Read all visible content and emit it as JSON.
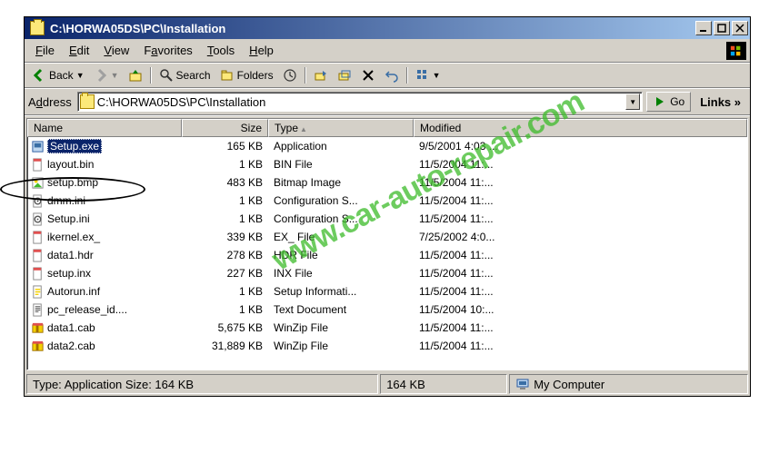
{
  "titlebar": {
    "title": "C:\\HORWA05DS\\PC\\Installation"
  },
  "menubar": {
    "file": "File",
    "edit": "Edit",
    "view": "View",
    "favorites": "Favorites",
    "tools": "Tools",
    "help": "Help"
  },
  "toolbar": {
    "back": "Back",
    "search": "Search",
    "folders": "Folders"
  },
  "addressbar": {
    "label": "Address",
    "path": "C:\\HORWA05DS\\PC\\Installation",
    "go": "Go",
    "links": "Links »"
  },
  "columns": {
    "name": "Name",
    "size": "Size",
    "type": "Type",
    "modified": "Modified"
  },
  "files": [
    {
      "name": "Setup.exe",
      "size": "165 KB",
      "type": "Application",
      "modified": "9/5/2001 4:03 ...",
      "icon": "app",
      "selected": true
    },
    {
      "name": "layout.bin",
      "size": "1 KB",
      "type": "BIN File",
      "modified": "11/5/2004 11:...",
      "icon": "bin"
    },
    {
      "name": "setup.bmp",
      "size": "483 KB",
      "type": "Bitmap Image",
      "modified": "11/5/2004 11:...",
      "icon": "bmp"
    },
    {
      "name": "dmm.ini",
      "size": "1 KB",
      "type": "Configuration S...",
      "modified": "11/5/2004 11:...",
      "icon": "ini"
    },
    {
      "name": "Setup.ini",
      "size": "1 KB",
      "type": "Configuration S...",
      "modified": "11/5/2004 11:...",
      "icon": "ini"
    },
    {
      "name": "ikernel.ex_",
      "size": "339 KB",
      "type": "EX_ File",
      "modified": "7/25/2002 4:0...",
      "icon": "bin"
    },
    {
      "name": "data1.hdr",
      "size": "278 KB",
      "type": "HDR File",
      "modified": "11/5/2004 11:...",
      "icon": "bin"
    },
    {
      "name": "setup.inx",
      "size": "227 KB",
      "type": "INX File",
      "modified": "11/5/2004 11:...",
      "icon": "bin"
    },
    {
      "name": "Autorun.inf",
      "size": "1 KB",
      "type": "Setup Informati...",
      "modified": "11/5/2004 11:...",
      "icon": "inf"
    },
    {
      "name": "pc_release_id....",
      "size": "1 KB",
      "type": "Text Document",
      "modified": "11/5/2004 10:...",
      "icon": "txt"
    },
    {
      "name": "data1.cab",
      "size": "5,675 KB",
      "type": "WinZip File",
      "modified": "11/5/2004 11:...",
      "icon": "cab"
    },
    {
      "name": "data2.cab",
      "size": "31,889 KB",
      "type": "WinZip File",
      "modified": "11/5/2004 11:...",
      "icon": "cab"
    }
  ],
  "statusbar": {
    "panel1": "Type: Application Size: 164 KB",
    "panel2": "164 KB",
    "panel3": "My Computer"
  },
  "watermark": "www.car-auto-repair.com"
}
